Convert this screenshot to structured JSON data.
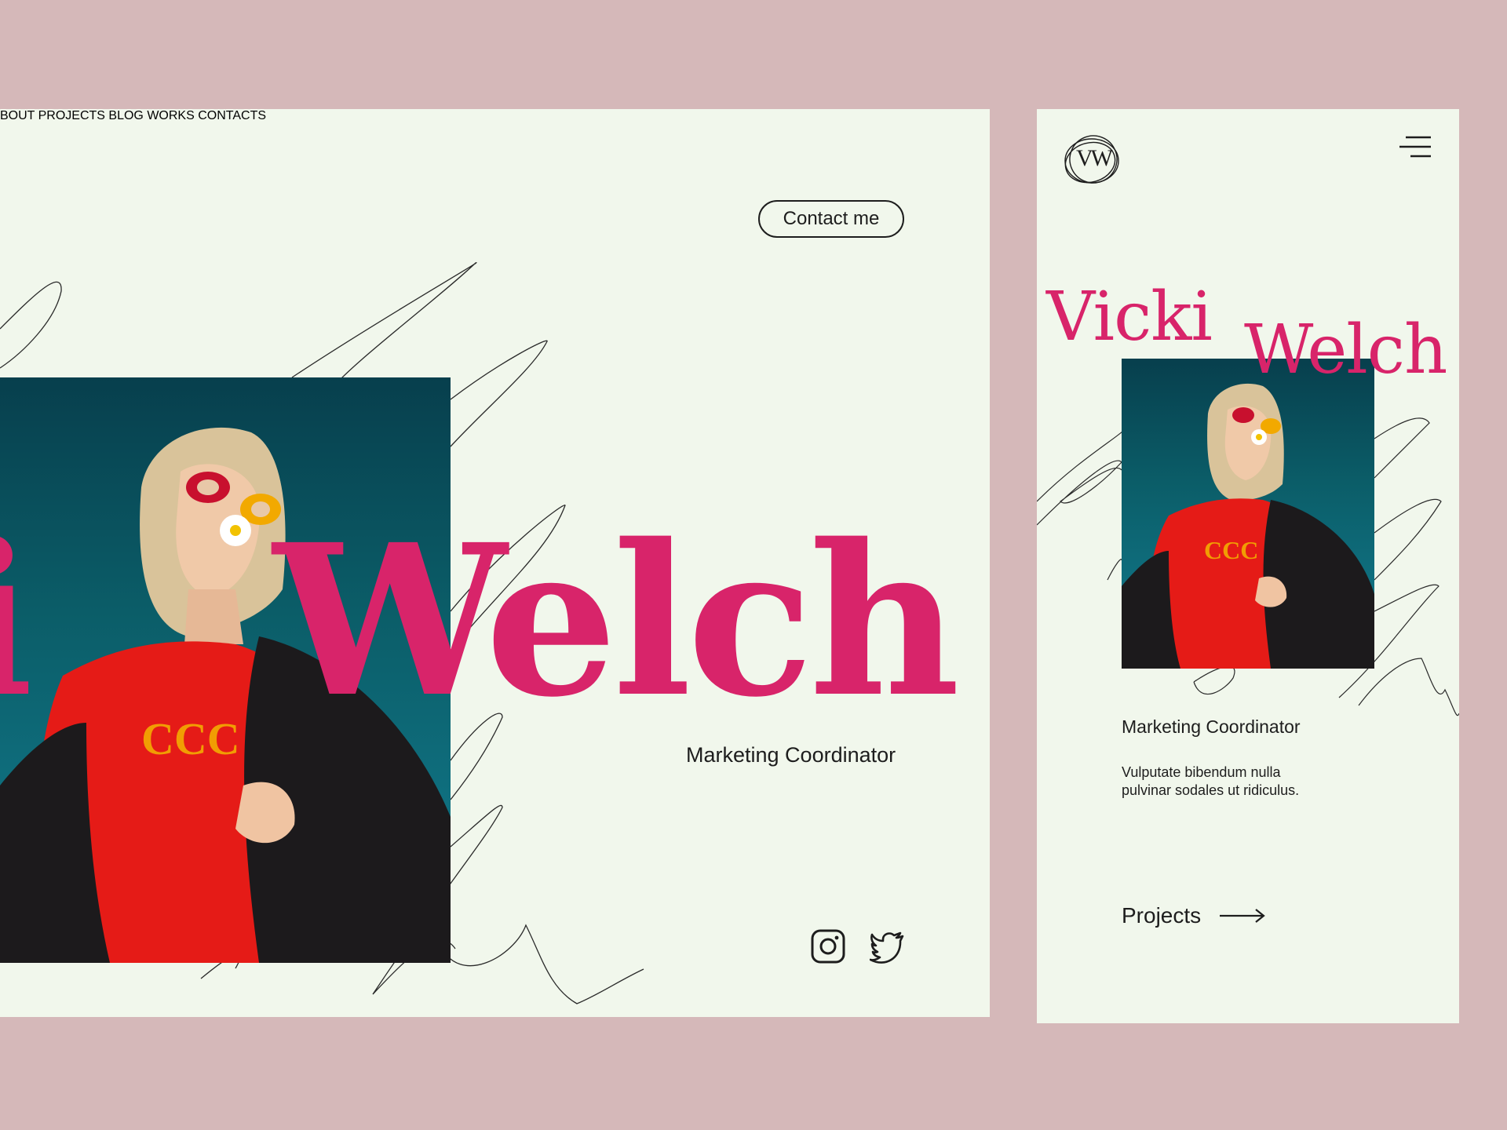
{
  "colors": {
    "background": "#d5b8b9",
    "card": "#f1f7ec",
    "accent": "#d8246a",
    "text": "#1d1d1d"
  },
  "desktop": {
    "nav": [
      {
        "label": "BOUT"
      },
      {
        "label": "PROJECTS"
      },
      {
        "label": "BLOG"
      },
      {
        "label": "WORKS"
      },
      {
        "label": "CONTACTS"
      }
    ],
    "contact_button": "Contact me",
    "name_first_visible": "i",
    "name_last": "Welch",
    "role": "Marketing Coordinator",
    "social_icons": [
      "instagram-icon",
      "twitter-icon"
    ]
  },
  "mobile": {
    "logo_text": "VW",
    "menu_icon": "hamburger-menu-icon",
    "name_first": "Vicki",
    "name_last": "Welch",
    "role": "Marketing Coordinator",
    "description": "Vulputate bibendum nulla pulvinar sodales ut ridiculus.",
    "projects_link": "Projects",
    "projects_icon": "arrow-right-icon"
  }
}
